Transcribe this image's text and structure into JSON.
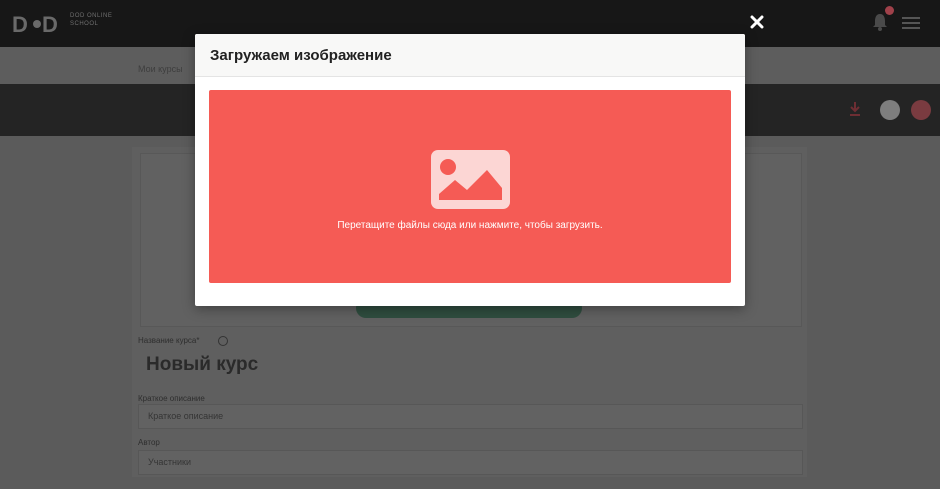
{
  "background": {
    "logo_text": "DOD ONLINE SCHOOL",
    "breadcrumb": "Мои курсы",
    "course_name_label": "Название курса*",
    "course_name_value": "Новый курс",
    "short_description_label": "Краткое описание",
    "short_description_placeholder": "Краткое описание",
    "author_label": "Автор",
    "author_placeholder": "Участники"
  },
  "modal": {
    "title": "Загружаем изображение",
    "dropzone_text": "Перетащите файлы сюда или нажмите, чтобы загрузить.",
    "close_icon": "close-icon",
    "upload_icon": "image-icon"
  },
  "colors": {
    "dropzone": "#f55b55",
    "overlay_background": "#5b5b5b",
    "modal_header": "#f8f8f7"
  }
}
